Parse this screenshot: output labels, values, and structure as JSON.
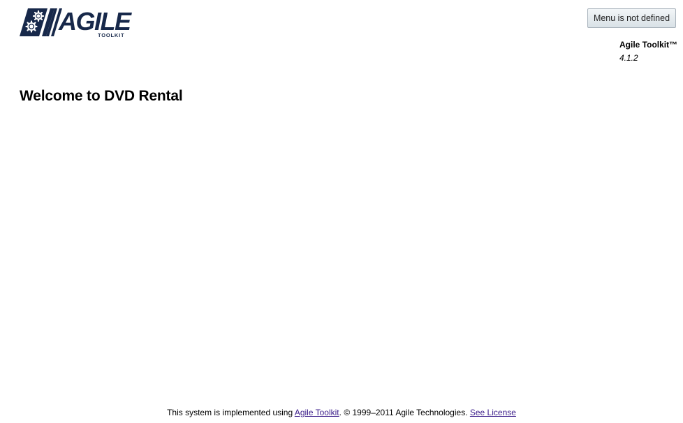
{
  "header": {
    "logo_text": "AGILE",
    "logo_subtext": "TOOLKIT",
    "menu_button_label": "Menu is not defined"
  },
  "version_info": {
    "name": "Agile Toolkit™",
    "version": "4.1.2"
  },
  "main": {
    "title": "Welcome to DVD Rental"
  },
  "footer": {
    "prefix": "This system is implemented using ",
    "toolkit_link": "Agile Toolkit",
    "copyright": ". © 1999–2011 Agile Technologies. ",
    "license_link": "See License"
  },
  "colors": {
    "logo": "#17284a",
    "link": "#3b1d8a"
  }
}
